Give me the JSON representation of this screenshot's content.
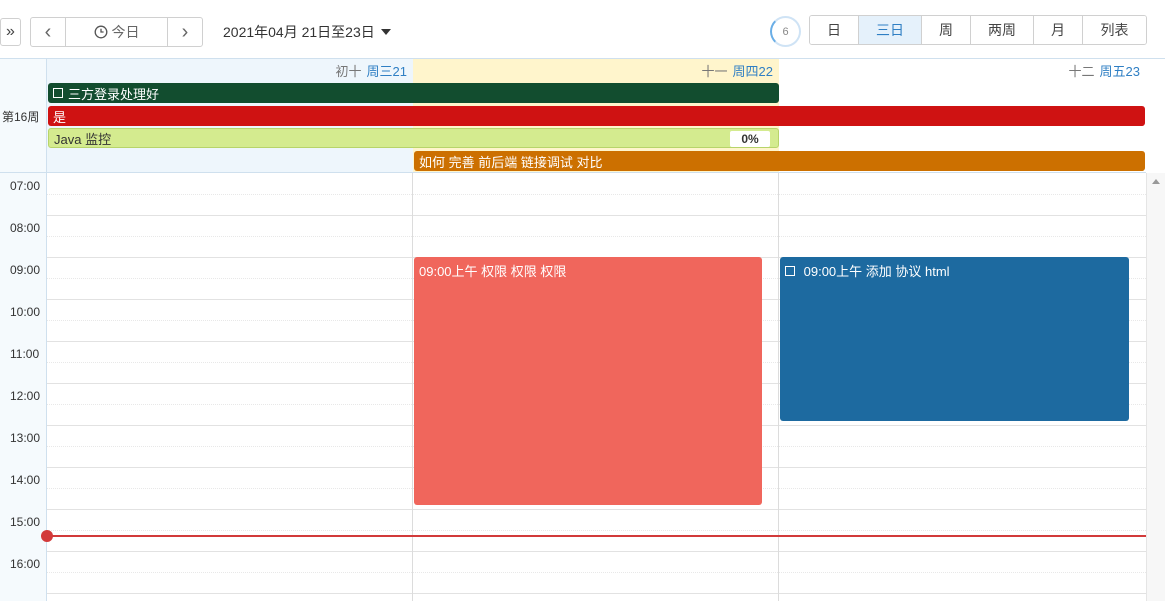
{
  "toolbar": {
    "expand_glyph": "»",
    "prev_glyph": "‹",
    "next_glyph": "›",
    "today_icon": "clock-icon",
    "today_label": "今日",
    "date_range": "2021年04月 21日至23日",
    "count": "6",
    "views": [
      {
        "label": "日",
        "active": false
      },
      {
        "label": "三日",
        "active": true
      },
      {
        "label": "周",
        "active": false
      },
      {
        "label": "两周",
        "active": false
      },
      {
        "label": "月",
        "active": false
      },
      {
        "label": "列表",
        "active": false
      }
    ]
  },
  "week_label": "第16周",
  "days": [
    {
      "lunar": "初十",
      "dow": "周三21",
      "bg": "#eef6fc"
    },
    {
      "lunar": "十一",
      "dow": "周四22",
      "bg": "#fff5cc"
    },
    {
      "lunar": "十二",
      "dow": "周五23",
      "bg": "#ffffff"
    }
  ],
  "allday_events": [
    {
      "title": "三方登录处理好",
      "checkbox": true,
      "color": "#124d2f"
    },
    {
      "title": "是",
      "checkbox": false,
      "color": "#cf1212"
    },
    {
      "title": "Java 监控",
      "checkbox": false,
      "color": "#d4eb8f",
      "text_color": "#333333",
      "progress": "0%"
    },
    {
      "title": "如何 完善 前后端 链接调试 对比",
      "checkbox": false,
      "color": "#cc7000"
    }
  ],
  "hours": [
    "07:00",
    "08:00",
    "09:00",
    "10:00",
    "11:00",
    "12:00",
    "13:00",
    "14:00",
    "15:00",
    "16:00"
  ],
  "timed_events": [
    {
      "title": "09:00上午 权限 权限 权限",
      "checkbox": false,
      "color": "#f0665c"
    },
    {
      "title": "09:00上午 添加 协议 html",
      "checkbox": true,
      "color": "#1d6aa0"
    }
  ]
}
